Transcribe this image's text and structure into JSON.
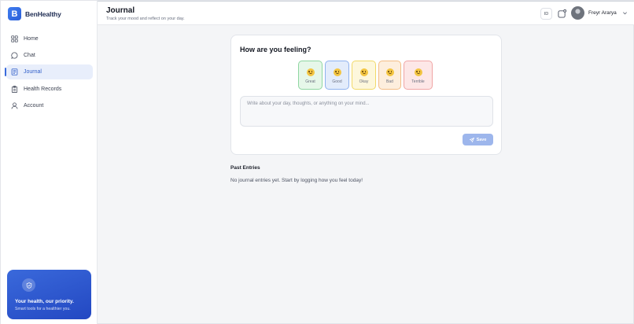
{
  "app": {
    "name": "BenHealthy",
    "logo_letter": "B"
  },
  "sidebar": {
    "items": [
      {
        "label": "Home",
        "icon": "dashboard-icon",
        "active": false
      },
      {
        "label": "Chat",
        "icon": "chat-bubble-icon",
        "active": false
      },
      {
        "label": "Journal",
        "icon": "journal-icon",
        "active": true
      },
      {
        "label": "Health Records",
        "icon": "clipboard-icon",
        "active": false
      },
      {
        "label": "Account",
        "icon": "user-icon",
        "active": false
      }
    ],
    "promo": {
      "title": "Your health, our priority.",
      "subtitle": "Smart tools for a healthier you.",
      "icon": "shield-icon"
    }
  },
  "header": {
    "title": "Journal",
    "subtitle": "Track your mood and reflect on your day.",
    "language": "ID",
    "user_name": "Freyr Ararya"
  },
  "journal": {
    "question": "How are you feeling?",
    "moods": [
      {
        "label": "Great",
        "bg": "#e6f7e9",
        "border": "#8fd6a1"
      },
      {
        "label": "Good",
        "bg": "#e3ecfb",
        "border": "#8fb2ee"
      },
      {
        "label": "Okay",
        "bg": "#fdf7dc",
        "border": "#f1d969"
      },
      {
        "label": "Bad",
        "bg": "#fdeedd",
        "border": "#f3bd86"
      },
      {
        "label": "Terrible",
        "bg": "#fde7e7",
        "border": "#f0a5a5"
      }
    ],
    "placeholder": "Write about your day, thoughts, or anything on your mind...",
    "save_label": "Save"
  },
  "past_entries": {
    "title": "Past Entries",
    "empty_message": "No journal entries yet. Start by logging how you feel today!"
  },
  "colors": {
    "accent": "#3a6bdc",
    "save_disabled": "#9db6ec"
  }
}
